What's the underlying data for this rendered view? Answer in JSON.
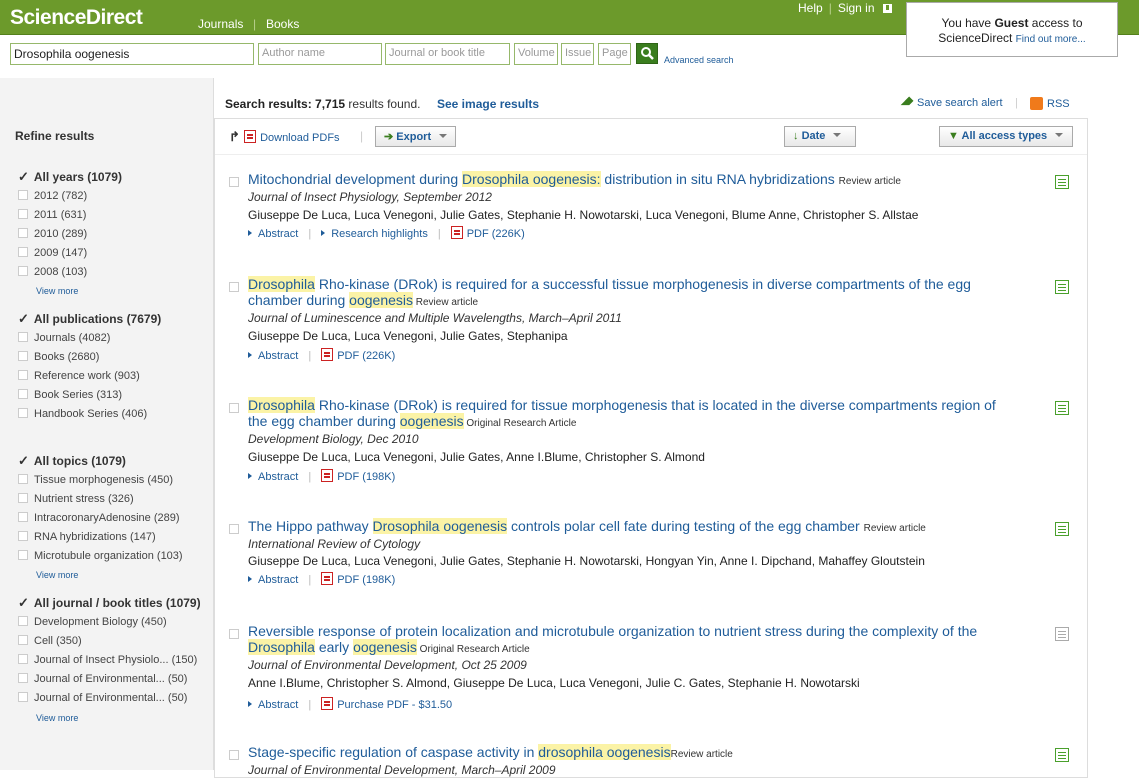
{
  "header": {
    "logo": "ScienceDirect",
    "nav": [
      "Journals",
      "Books"
    ],
    "help": "Help",
    "signin": "Sign in",
    "guest_pre": "You have ",
    "guest_bold": "Guest",
    "guest_post": " access to",
    "guest_line2": "ScienceDirect ",
    "guest_link": "Find out more..."
  },
  "search": {
    "query": "Drosophila oogenesis",
    "author_ph": "Author name",
    "journal_ph": "Journal or book title",
    "volume_ph": "Volume",
    "issue_ph": "Issue",
    "page_ph": "Page",
    "advanced": "Advanced search"
  },
  "summary": {
    "label": "Search results: ",
    "count": "7,715",
    "suffix": " results found.",
    "image_results": "See image results",
    "save_alert": "Save search alert",
    "rss": "RSS"
  },
  "refine": {
    "title": "Refine results",
    "years_title": "All years (1079)",
    "years": [
      "2012  (782)",
      "2011  (631)",
      "2010  (289)",
      "2009  (147)",
      "2008  (103)"
    ],
    "pubs_title": "All publications (7679)",
    "pubs": [
      "Journals (4082)",
      "Books (2680)",
      "Reference work (903)",
      "Book Series (313)",
      "Handbook Series (406)"
    ],
    "topics_title": "All topics  (1079)",
    "topics": [
      "Tissue morphogenesis  (450)",
      "Nutrient stress  (326)",
      "IntracoronaryAdenosine  (289)",
      "RNA hybridizations  (147)",
      "Microtubule organization  (103)"
    ],
    "titles_title": "All journal / book titles  (1079)",
    "titles": [
      "Development Biology  (450)",
      "Cell  (350)",
      "Journal of Insect Physiolo... (150)",
      "Journal of Environmental...  (50)",
      "Journal of Environmental...  (50)"
    ],
    "view_more": "View  more"
  },
  "toolbar": {
    "download": "Download PDFs",
    "export": "Export",
    "date": "Date",
    "access": "All access types"
  },
  "results": [
    {
      "t1": "Mitochondrial development during ",
      "h1": "Drosophila oogenesis:",
      "t2": " distribution in situ RNA hybridizations ",
      "type": "Review article",
      "journal": "Journal of Insect Physiology, September 2012",
      "authors": "Giuseppe De Luca, Luca Venegoni, Julie Gates, Stephanie H. Nowotarski, Luca Venegoni, Blume Anne, Christopher S. Allstae",
      "abstract": "Abstract",
      "highlights": "Research highlights",
      "pdf": "PDF (226K)"
    },
    {
      "h1": "Drosophila",
      "t1": " Rho-kinase (DRok) is required for a successful tissue morphogenesis in diverse compartments of the egg chamber during ",
      "h2": "oogenesis",
      "type": " Review article",
      "journal": "Journal of Luminescence and Multiple Wavelengths, March–April 2011",
      "authors": "Giuseppe De Luca, Luca Venegoni, Julie Gates, Stephanipa",
      "abstract": "Abstract",
      "pdf": "PDF (226K)"
    },
    {
      "h1": "Drosophila",
      "t1": " Rho-kinase (DRok) is required for tissue morphogenesis that is located in the diverse compartments region of the egg chamber during ",
      "h2": "oogenesis",
      "type": " Original Research Article",
      "journal": "Development Biology, Dec 2010",
      "authors": "Giuseppe De Luca, Luca Venegoni, Julie Gates, Anne I.Blume, Christopher S. Almond",
      "abstract": "Abstract",
      "pdf": "PDF (198K)"
    },
    {
      "t1": "The Hippo pathway ",
      "h1": "Drosophila oogenesis",
      "t2": " controls polar cell fate during testing of the egg chamber ",
      "type": "Review article",
      "journal": "International Review of Cytology",
      "authors": "Giuseppe De Luca, Luca Venegoni, Julie Gates, Stephanie H. Nowotarski, Hongyan Yin, Anne I. Dipchand, Mahaffey Gloutstein",
      "abstract": "Abstract",
      "pdf": "PDF (198K)"
    },
    {
      "t1": "Reversible response of protein localization and microtubule organization to nutrient stress during the complexity of the ",
      "h1": "Drosophila",
      "t2": " early ",
      "h2": "oogenesis",
      "type": " Original Research Article",
      "journal": "Journal of Environmental Development, Oct 25 2009",
      "authors": " Anne I.Blume, Christopher S. Almond, Giuseppe De Luca, Luca Venegoni, Julie C. Gates, Stephanie H. Nowotarski",
      "abstract": "Abstract",
      "pdf": "Purchase PDF - $31.50"
    },
    {
      "t1": "Stage-specific regulation of caspase activity in ",
      "h1": "drosophila oogenesis",
      "type": "Review article",
      "journal": "Journal of Environmental Development, March–April 2009"
    }
  ]
}
